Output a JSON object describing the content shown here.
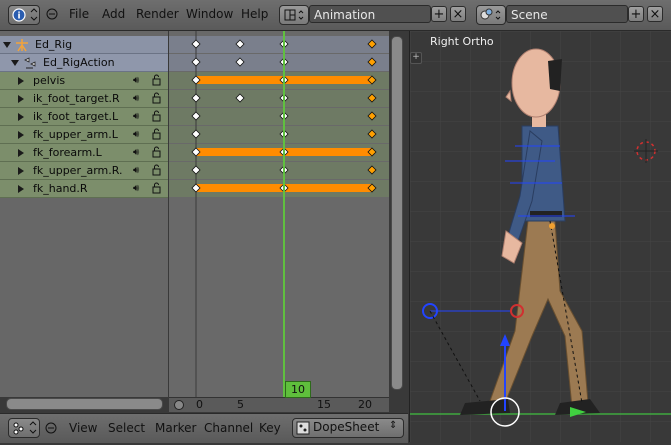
{
  "header": {
    "menu": [
      "File",
      "Add",
      "Render",
      "Window",
      "Help"
    ],
    "screen_layout": "Animation",
    "scene": "Scene"
  },
  "channels": {
    "object": "Ed_Rig",
    "action": "Ed_RigAction",
    "items": [
      "pelvis",
      "ik_foot_target.R",
      "ik_foot_target.L",
      "fk_upper_arm.L",
      "fk_forearm.L",
      "fk_upper_arm.R.",
      "fk_hand.R"
    ]
  },
  "timeline": {
    "current_frame": "10",
    "ticks": [
      "0",
      "5",
      "10",
      "15",
      "20"
    ]
  },
  "footer": {
    "menu": [
      "View",
      "Select",
      "Marker",
      "Channel",
      "Key"
    ],
    "mode": "DopeSheet"
  },
  "viewport": {
    "title": "Right Ortho"
  },
  "colors": {
    "keyframe_selected": "#ffa000",
    "keyframe": "#ffffff",
    "hold_bar": "#ff8c00",
    "playhead": "#60c040",
    "channel_green": "#7c8e6b",
    "object_row": "#8b93a6"
  },
  "chart_data": {
    "type": "table",
    "columns": [
      "channel",
      "keyframes"
    ],
    "rows": [
      {
        "channel": "Ed_Rig",
        "keys": [
          0,
          5,
          10,
          20
        ]
      },
      {
        "channel": "Ed_RigAction",
        "keys": [
          0,
          5,
          10,
          20
        ]
      },
      {
        "channel": "pelvis",
        "keys": [
          0,
          10,
          20
        ],
        "hold": [
          0,
          20
        ]
      },
      {
        "channel": "ik_foot_target.R",
        "keys": [
          0,
          5,
          10,
          20
        ]
      },
      {
        "channel": "ik_foot_target.L",
        "keys": [
          0,
          10,
          20
        ]
      },
      {
        "channel": "fk_upper_arm.L",
        "keys": [
          0,
          10,
          20
        ]
      },
      {
        "channel": "fk_forearm.L",
        "keys": [
          0,
          10,
          20
        ],
        "hold": [
          0,
          20
        ]
      },
      {
        "channel": "fk_upper_arm.R.",
        "keys": [
          0,
          10,
          20
        ]
      },
      {
        "channel": "fk_hand.R",
        "keys": [
          0,
          10,
          20
        ],
        "hold": [
          0,
          20
        ]
      }
    ],
    "frame_range": [
      0,
      20
    ],
    "current_frame": 10
  }
}
